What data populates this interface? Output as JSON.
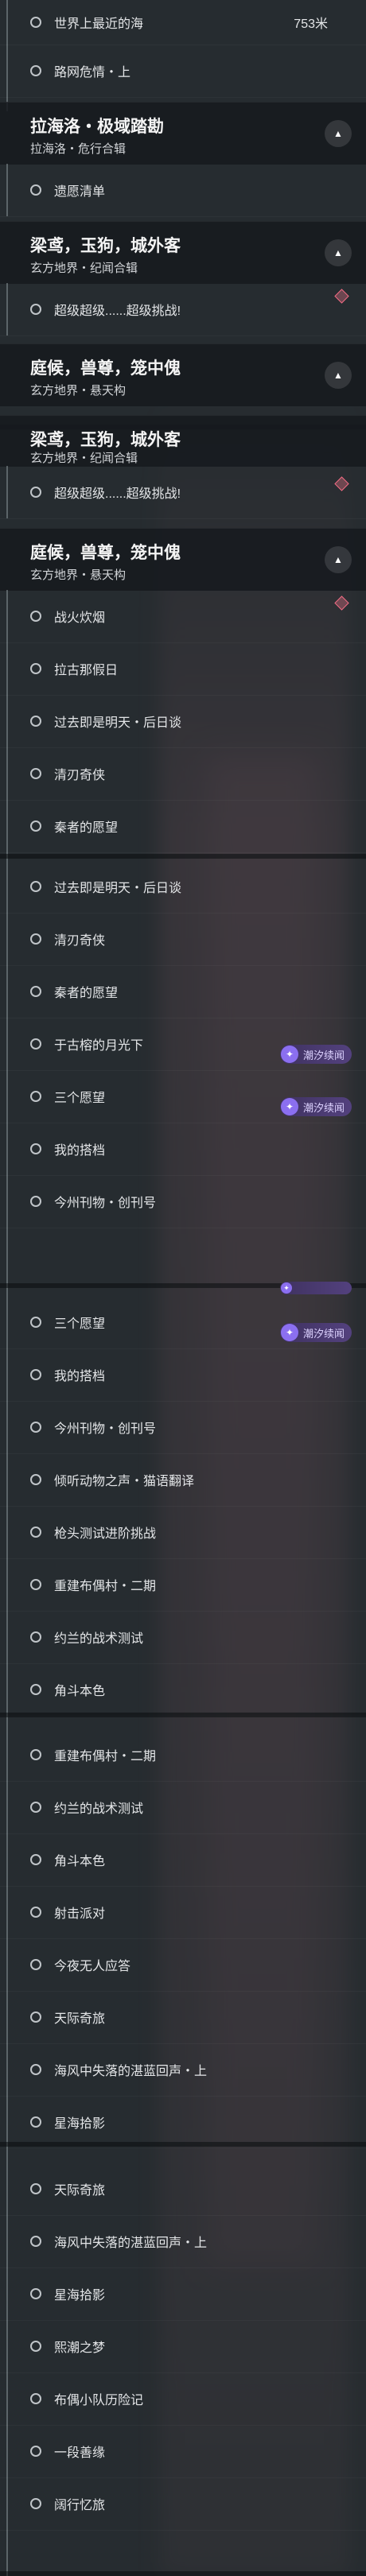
{
  "s1": {
    "item_top": {
      "label": "世界上最近的海",
      "distance": "753米"
    },
    "item_2": "路网危情・上",
    "header_a": {
      "title": "拉海洛・极域踏勘",
      "sub": "拉海洛・危行合辑"
    },
    "item_3": "遗愿清单",
    "header_b": {
      "title": "梁鸢，玉狗，城外客",
      "sub": "玄方地界・纪闻合辑"
    },
    "item_4": "超级超级......超级挑战!",
    "header_c": {
      "title": "庭候，兽尊，笼中傀",
      "sub": "玄方地界・悬天构"
    }
  },
  "s2": {
    "partial_header": {
      "title": "梁鸢，玉狗，城外客",
      "sub": "玄方地界・纪闻合辑"
    },
    "item_1": "超级超级......超级挑战!",
    "header": {
      "title": "庭候，兽尊，笼中傀",
      "sub": "玄方地界・悬天构"
    },
    "items": [
      "战火炊烟",
      "拉古那假日",
      "过去即是明天・后日谈",
      "清刃奇侠",
      "秦者的愿望"
    ]
  },
  "s3": {
    "items": [
      "过去即是明天・后日谈",
      "清刃奇侠",
      "秦者的愿望",
      "于古榕的月光下",
      "三个愿望",
      "我的搭档",
      "今州刊物・创刊号"
    ],
    "badge": "潮汐续闻"
  },
  "s4": {
    "items": [
      "三个愿望",
      "我的搭档",
      "今州刊物・创刊号",
      "倾听动物之声・猫语翻译",
      "枪头测试进阶挑战",
      "重建布偶村・二期",
      "约兰的战术测试",
      "角斗本色"
    ],
    "badge": "潮汐续闻"
  },
  "s5": {
    "items": [
      "重建布偶村・二期",
      "约兰的战术测试",
      "角斗本色",
      "射击派对",
      "今夜无人应答",
      "天际奇旅",
      "海风中失落的湛蓝回声・上",
      "星海拾影"
    ]
  },
  "s6": {
    "items": [
      "天际奇旅",
      "海风中失落的湛蓝回声・上",
      "星海拾影",
      "熙潮之梦",
      "布偶小队历险记",
      "一段善缘",
      "阔行忆旅"
    ]
  },
  "colors": {
    "accent_diamond": "#ef6a82",
    "badge_purple": "#8b6ff0"
  },
  "icons": {
    "collapse": "chevron-up-icon",
    "radio": "circle-outline-icon",
    "badge": "tide-badge-icon",
    "diamond": "diamond-marker-icon"
  }
}
